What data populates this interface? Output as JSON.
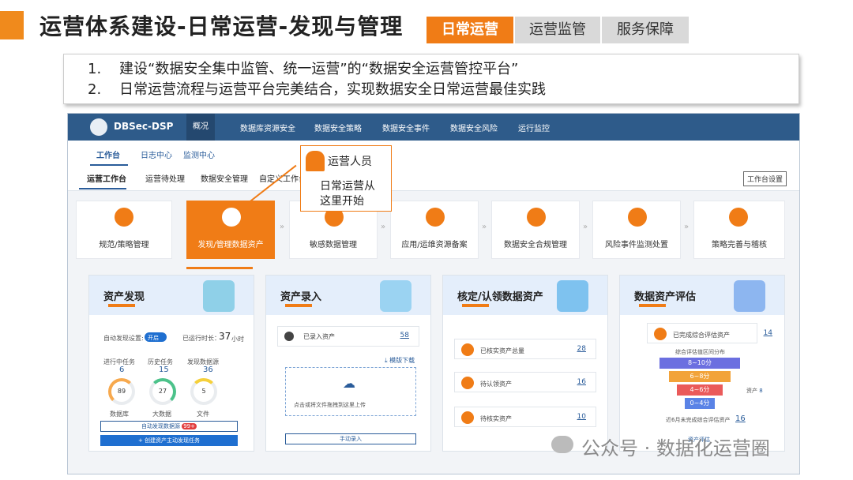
{
  "header": {
    "title": "运营体系建设-日常运营-发现与管理"
  },
  "tabs": [
    "日常运营",
    "运营监管",
    "服务保障"
  ],
  "summary": {
    "items": [
      {
        "num": "1.",
        "text": "建设“数据安全集中监管、统一运营”的“数据安全运营管控平台”"
      },
      {
        "num": "2.",
        "text": "日常运营流程与运营平台完美结合，实现数据安全日常运营最佳实践"
      }
    ]
  },
  "app": {
    "name": "DBSec-DSP",
    "nav": [
      "概况",
      "数据库资源安全",
      "数据安全策略",
      "数据安全事件",
      "数据安全风险",
      "运行监控"
    ],
    "subnav1": [
      "工作台",
      "日志中心",
      "监测中心"
    ],
    "subnav2": [
      "运营工作台",
      "运营待处理",
      "数据安全管理",
      "自定义工作台"
    ],
    "workbench_settings": "工作台设置",
    "steps": [
      "规范/策略管理",
      "发现/管理数据资产",
      "敏感数据管理",
      "应用/运维资源备案",
      "数据安全合规管理",
      "风险事件监测处置",
      "策略完善与稽核"
    ],
    "callout": {
      "title": "运营人员",
      "line1": "日常运营从",
      "line2": "这里开始"
    }
  },
  "cards": {
    "discovery": {
      "title": "资产发现",
      "auto_label": "自动发现设置:",
      "toggle": "开启",
      "runtime_label": "已运行时长：",
      "runtime_value": "37",
      "runtime_unit": "小时",
      "stats": [
        {
          "label": "进行中任务",
          "count": "6",
          "ring": "89",
          "legend": "数据库"
        },
        {
          "label": "历史任务",
          "count": "15",
          "ring": "27",
          "legend": "大数据"
        },
        {
          "label": "发现数据源",
          "count": "36",
          "ring": "5",
          "legend": "文件"
        }
      ],
      "btn_outline": "自动发现数据源",
      "badge": "99+",
      "btn_filled": "+ 创建资产主动发现任务"
    },
    "entry": {
      "title": "资产录入",
      "recorded_label": "已录入资产",
      "recorded_value": "58",
      "download": "模版下载",
      "upload": "点击或将文件拖拽到这里上传",
      "manual": "手动录入"
    },
    "verify": {
      "title": "核定/认领数据资产",
      "rows": [
        {
          "label": "已核实资产总量",
          "value": "28"
        },
        {
          "label": "待认领资产",
          "value": "16"
        },
        {
          "label": "待核实资产",
          "value": "10"
        }
      ]
    },
    "evaluate": {
      "title": "数据资产评估",
      "done_label": "已完成综合评估资产",
      "done_value": "14",
      "dist_label": "综合评估值区间分布",
      "bands": [
        "8~10分",
        "6~8分",
        "4~6分",
        "0~4分"
      ],
      "asset_tag": "资产",
      "asset_count": "8",
      "pending_label": "近6月未完成综合评估资产",
      "pending_value": "16",
      "bottom_link": "资产评估"
    }
  },
  "watermark": "公众号 · 数据化运营圈",
  "colors": {
    "accent": "#f07c16",
    "nav": "#2e5b8a",
    "link": "#2a5c9a"
  }
}
